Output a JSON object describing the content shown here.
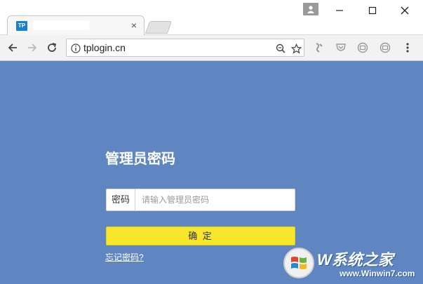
{
  "tab": {
    "favicon_text": "TP",
    "close_glyph": "×"
  },
  "address_bar": {
    "url": "tplogin.cn"
  },
  "login": {
    "title": "管理员密码",
    "password_label": "密码",
    "password_placeholder": "请输入管理员密码",
    "confirm_label": "确 定",
    "forgot_label": "忘记密码?"
  },
  "watermark": {
    "brand": "W系统之家",
    "url": "www.Winwin7.com"
  },
  "colors": {
    "page_background": "#5f86c0",
    "confirm_button": "#f7e62a",
    "favicon": "#1b7fd1"
  },
  "icons": {
    "window": [
      "profile-icon",
      "minimize-icon",
      "maximize-icon",
      "close-icon"
    ],
    "nav": [
      "back-arrow-icon",
      "forward-arrow-icon",
      "reload-icon"
    ],
    "omnibox": [
      "info-icon",
      "zoom-icon",
      "bookmark-star-icon"
    ],
    "extensions": [
      "extension-1-icon",
      "extension-2-icon",
      "extension-3-icon",
      "extension-4-icon",
      "menu-dots-icon"
    ]
  }
}
